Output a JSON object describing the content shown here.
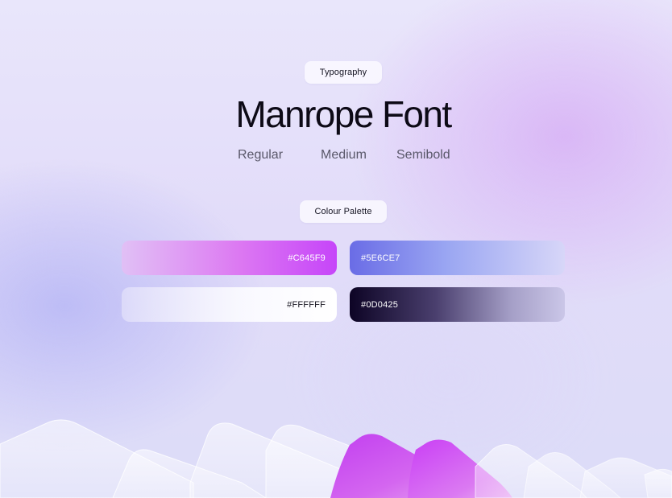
{
  "sections": {
    "typography_label": "Typography",
    "palette_label": "Colour Palette"
  },
  "font": {
    "title": "Manrope Font",
    "weights": [
      "Regular",
      "Medium",
      "Semibold"
    ]
  },
  "palette": [
    {
      "hex": "#C645F9",
      "color": "#C645F9"
    },
    {
      "hex": "#5E6CE7",
      "color": "#5E6CE7"
    },
    {
      "hex": "#FFFFFF",
      "color": "#FFFFFF"
    },
    {
      "hex": "#0D0425",
      "color": "#0D0425"
    }
  ]
}
